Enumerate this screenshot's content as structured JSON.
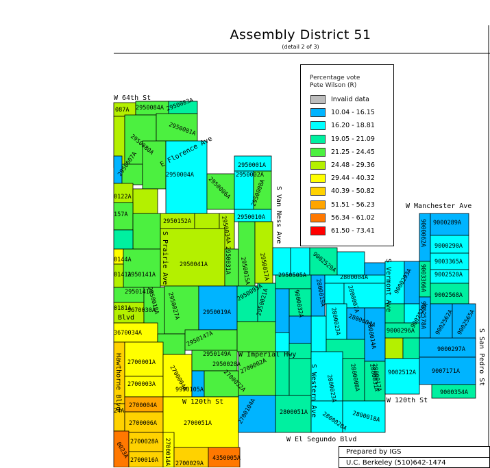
{
  "header": {
    "title": "Assembly District 51",
    "subtitle": "(detail 2 of 3)"
  },
  "legend": {
    "title_line1": "Percentage vote",
    "title_line2": "Pete Wilson (R)",
    "items": [
      {
        "label": "Invalid data",
        "color": "#bdbdbd"
      },
      {
        "label": "10.04 - 16.15",
        "color": "#00b4ff"
      },
      {
        "label": "16.20 - 18.81",
        "color": "#00ffff"
      },
      {
        "label": "19.05 - 21.09",
        "color": "#00f0a0"
      },
      {
        "label": "21.25 - 24.45",
        "color": "#4cf040"
      },
      {
        "label": "24.48 - 29.36",
        "color": "#b4f000"
      },
      {
        "label": "29.44 - 40.32",
        "color": "#ffff00"
      },
      {
        "label": "40.39 - 50.82",
        "color": "#ffd200"
      },
      {
        "label": "51.51 - 56.23",
        "color": "#ffa500"
      },
      {
        "label": "56.34 - 61.02",
        "color": "#ff7800"
      },
      {
        "label": "61.50 - 73.41",
        "color": "#ff0000"
      }
    ]
  },
  "credit": {
    "line1": "Prepared by IGS",
    "line2": "U.C. Berkeley (510)642-1474"
  },
  "streets": [
    "W 64th St",
    "E Florence Ave",
    "S Prairie Ave",
    "S Van Ness Ave",
    "W Manchester Ave",
    "S Vermont Ave",
    "W Imperial Hwy",
    "Hawthorne Blvd",
    "W 120th St",
    "W 120th St",
    "S Western Ave",
    "W El Segundo Blvd",
    "S San Pedro St",
    "Blvd"
  ],
  "precincts": [
    "087A",
    "2950084A",
    "2950083A",
    "2950081A",
    "2950080A",
    "2950007A",
    "2950004A",
    "2950001A",
    "2950002A",
    "2950006A",
    "2950008A",
    "2950010A",
    "0122A",
    "157A",
    "2950152A",
    "2950034A",
    "2950041A",
    "2950031A",
    "2950015A",
    "2950017A",
    "9000289A",
    "9000290A",
    "9003365A",
    "9002520A",
    "9002568A",
    "9000062A",
    "9000293A",
    "9003366A",
    "9002525A",
    "9000296A",
    "9002578A",
    "9002562A",
    "9002565A",
    "9000297A",
    "9002512A",
    "9007171A",
    "9000354A",
    "9002529A",
    "2950505A",
    "2800004A",
    "2800004A",
    "2800007A",
    "2800014A",
    "2800019A",
    "9000032A",
    "2800023A",
    "2800031A",
    "2800008A",
    "0144A",
    "0141A",
    "2950141A",
    "2950141B",
    "0181A",
    "3670030A",
    "2950018A",
    "2950027A",
    "2950019A",
    "2950095A",
    "2950021A",
    "2950147A",
    "2950149A",
    "3670034A",
    "2700001A",
    "2700003A",
    "2700004A",
    "9990105A",
    "2950028A",
    "2700032A",
    "2700002A",
    "2700004A",
    "2700006A",
    "2700051A",
    "2700028A",
    "2700014A",
    "2700016A",
    "2700029A",
    "4350005A",
    "0023A",
    "2700104A",
    "2800051A",
    "2800023A",
    "2800020A",
    "2800018A",
    "2800017A",
    "24A"
  ]
}
